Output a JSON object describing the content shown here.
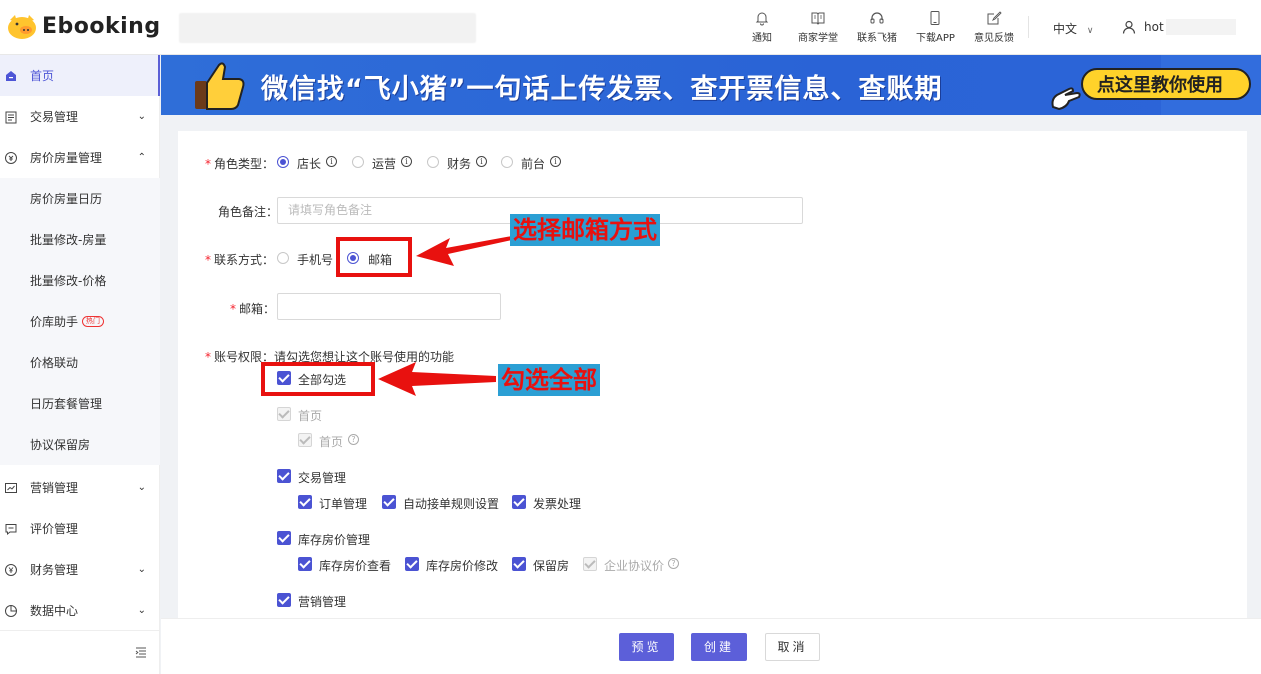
{
  "header": {
    "logo_text": "Ebooking",
    "search_placeholder": "",
    "tools": [
      {
        "label": "通知",
        "icon": "bell-icon"
      },
      {
        "label": "商家学堂",
        "icon": "book-icon"
      },
      {
        "label": "联系飞猪",
        "icon": "headset-icon"
      },
      {
        "label": "下载APP",
        "icon": "phone-icon"
      },
      {
        "label": "意见反馈",
        "icon": "edit-icon"
      }
    ],
    "language": "中文",
    "user": "hot"
  },
  "sidebar": {
    "items": [
      {
        "label": "首页",
        "icon": "home-icon",
        "active": true
      },
      {
        "label": "交易管理",
        "icon": "order-icon",
        "chevron": "down"
      },
      {
        "label": "房价房量管理",
        "icon": "price-icon",
        "chevron": "up"
      },
      {
        "label": "营销管理",
        "icon": "marketing-icon",
        "chevron": "down"
      },
      {
        "label": "评价管理",
        "icon": "comment-icon"
      },
      {
        "label": "财务管理",
        "icon": "finance-icon",
        "chevron": "down"
      },
      {
        "label": "数据中心",
        "icon": "chart-icon",
        "chevron": "down"
      }
    ],
    "sub_items": [
      "房价房量日历",
      "批量修改-房量",
      "批量修改-价格",
      "价库助手",
      "价格联动",
      "日历套餐管理",
      "协议保留房"
    ],
    "hot_badge": "热门"
  },
  "banner": {
    "text": "微信找“飞小猪”一句话上传发票、查开票信息、查账期",
    "cta": "点这里教你使用"
  },
  "form": {
    "role_type_label": "角色类型",
    "role_options": [
      "店长",
      "运营",
      "财务",
      "前台"
    ],
    "role_selected": "店长",
    "role_note_label": "角色备注",
    "role_note_placeholder": "请填写角色备注",
    "contact_label": "联系方式",
    "contact_options": [
      "手机号",
      "邮箱"
    ],
    "contact_selected": "邮箱",
    "email_label": "邮箱",
    "email_value": "",
    "permission_label": "账号权限",
    "permission_hint": "请勾选您想让这个账号使用的功能",
    "select_all": "全部勾选",
    "groups": [
      {
        "name": "首页",
        "disabled": true,
        "children": [
          {
            "name": "首页",
            "disabled": true,
            "help": true
          }
        ]
      },
      {
        "name": "交易管理",
        "children": [
          {
            "name": "订单管理"
          },
          {
            "name": "自动接单规则设置"
          },
          {
            "name": "发票处理"
          }
        ]
      },
      {
        "name": "库存房价管理",
        "children": [
          {
            "name": "库存房价查看"
          },
          {
            "name": "库存房价修改"
          },
          {
            "name": "保留房"
          },
          {
            "name": "企业协议价",
            "disabled": true,
            "help": true
          }
        ]
      },
      {
        "name": "营销管理",
        "children": []
      }
    ]
  },
  "annotations": {
    "email_tip": "选择邮箱方式",
    "select_all_tip": "勾选全部"
  },
  "footer": {
    "preview": "预览",
    "create": "创建",
    "cancel": "取消"
  },
  "colors": {
    "primary": "#5c5fd9",
    "annotation_red": "#e8110f",
    "annotation_tag_bg": "#2b9fd4",
    "banner_blue": "#2f6ed8",
    "banner_cta": "#ffd22a"
  }
}
